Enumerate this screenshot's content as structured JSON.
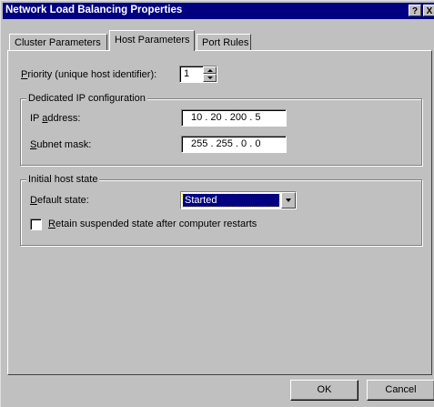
{
  "window": {
    "title": "Network Load Balancing Properties",
    "help_button": "?",
    "close_button": "X"
  },
  "tabs": [
    {
      "label": "Cluster Parameters",
      "active": false
    },
    {
      "label": "Host Parameters",
      "active": true
    },
    {
      "label": "Port Rules",
      "active": false
    }
  ],
  "priority": {
    "label_mnemonic": "P",
    "label_rest": "riority (unique host identifier):",
    "value": "1"
  },
  "dedicated_ip": {
    "legend": "Dedicated IP configuration",
    "ip_label_pre": "IP ",
    "ip_label_mnemonic": "a",
    "ip_label_post": "ddress:",
    "ip_value": "10 . 20 . 200 . 5",
    "subnet_label_mnemonic": "S",
    "subnet_label_rest": "ubnet mask:",
    "subnet_value": "255 . 255 . 0 . 0"
  },
  "initial_state": {
    "legend": "Initial host state",
    "default_label_mnemonic": "D",
    "default_label_rest": "efault state:",
    "default_value": "Started",
    "retain_label_mnemonic": "R",
    "retain_label_rest": "etain suspended state after computer restarts",
    "retain_checked": false
  },
  "buttons": {
    "ok": "OK",
    "cancel": "Cancel"
  }
}
